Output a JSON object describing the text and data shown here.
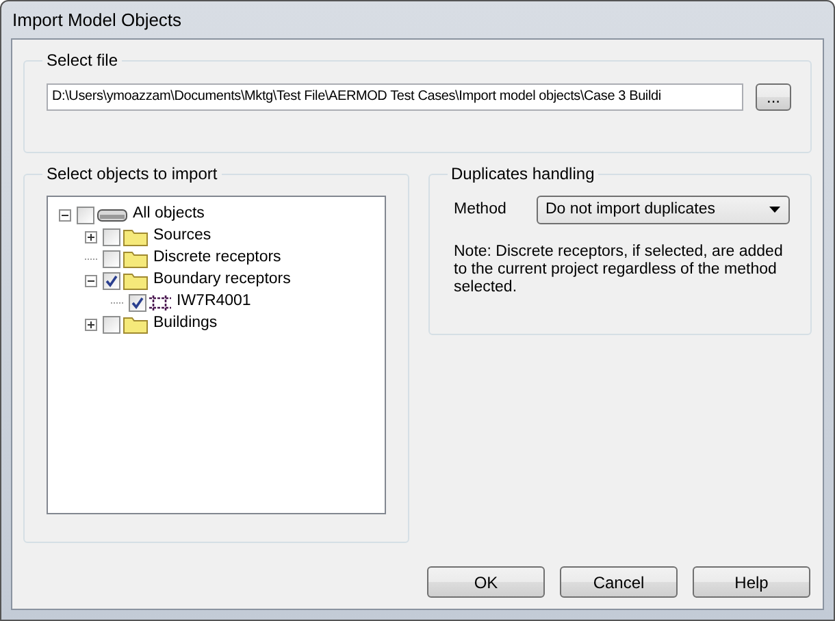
{
  "window": {
    "title": "Import Model Objects"
  },
  "select_file": {
    "title": "Select file",
    "path": "D:\\Users\\ymoazzam\\Documents\\Mktg\\Test File\\AERMOD Test Cases\\Import model objects\\Case 3 Buildi",
    "browse_button": "..."
  },
  "select_objects": {
    "title": "Select objects to import",
    "tree": [
      {
        "label": "All objects",
        "kind": "drive",
        "checked": false,
        "expanded": true,
        "children": [
          {
            "label": "Sources",
            "kind": "folder",
            "checked": false,
            "expanded": false
          },
          {
            "label": "Discrete receptors",
            "kind": "folder",
            "checked": false
          },
          {
            "label": "Boundary receptors",
            "kind": "folder",
            "checked": true,
            "expanded": true,
            "children": [
              {
                "label": "IW7R4001",
                "kind": "boundary",
                "checked": true
              }
            ]
          },
          {
            "label": "Buildings",
            "kind": "folder",
            "checked": false,
            "expanded": false
          }
        ]
      }
    ]
  },
  "duplicates_handling": {
    "title": "Duplicates handling",
    "method_label": "Method",
    "method_value": "Do not import duplicates",
    "note": "Note: Discrete receptors, if selected, are added to the current project regardless of the method selected."
  },
  "buttons": [
    "OK",
    "Cancel",
    "Help"
  ]
}
